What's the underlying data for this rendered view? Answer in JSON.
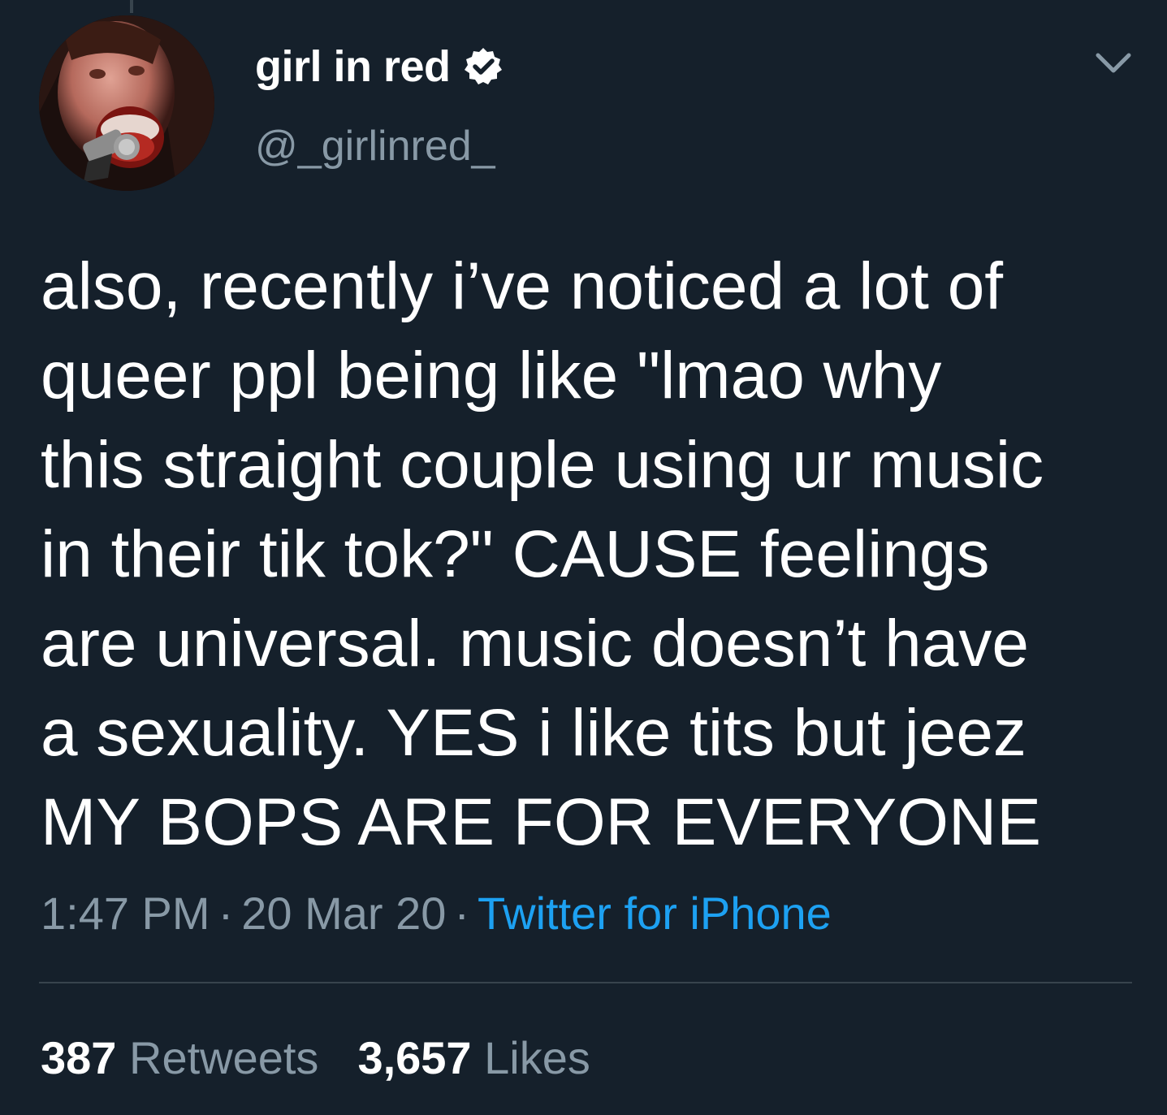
{
  "tweet": {
    "display_name": "girl in red",
    "handle": "@_girlinred_",
    "text_lines": [
      "also, recently i’ve noticed a lot of",
      "queer ppl being like \"lmao why",
      "this straight couple using ur music",
      "in their tik tok?\" CAUSE feelings",
      "are universal. music doesn’t have",
      "a sexuality. YES i like tits but jeez",
      "MY BOPS ARE FOR EVERYONE"
    ],
    "time": "1:47 PM",
    "date": "20 Mar 20",
    "source": "Twitter for iPhone",
    "separator": "·"
  },
  "stats": {
    "retweets_count": "387",
    "retweets_label": "Retweets",
    "likes_count": "3,657",
    "likes_label": "Likes"
  },
  "icons": {
    "verified": "verified-badge-icon",
    "more": "chevron-down-icon"
  },
  "colors": {
    "background": "#15202b",
    "primary_text": "#ffffff",
    "secondary_text": "#8899a6",
    "link": "#1da1f2",
    "divider": "#38444d"
  }
}
